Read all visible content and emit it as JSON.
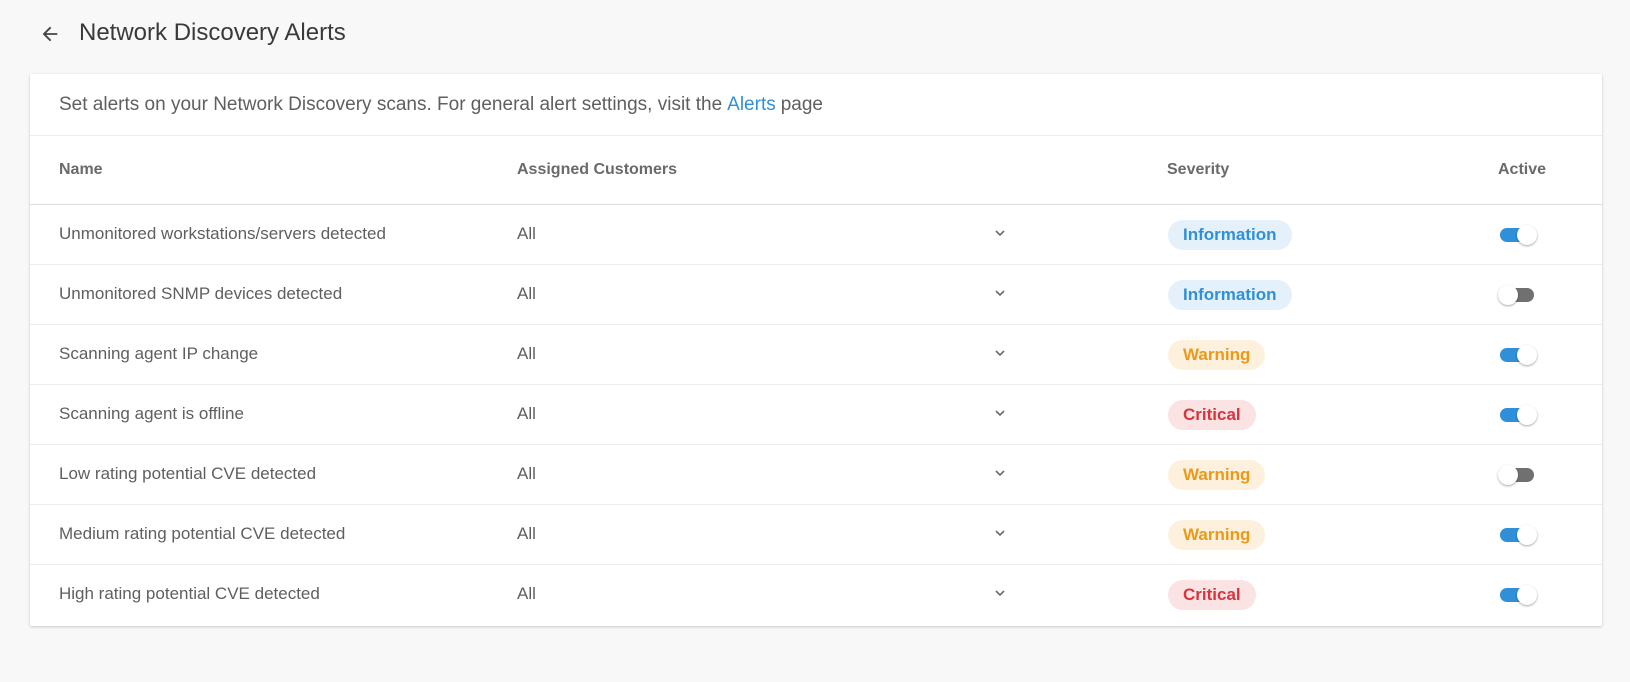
{
  "header": {
    "title": "Network Discovery Alerts",
    "back_icon": "arrow-left-icon"
  },
  "intro": {
    "text_before": "Set alerts on your Network Discovery scans. For general alert settings, visit the",
    "link_label": "Alerts",
    "text_after": "page"
  },
  "table": {
    "columns": {
      "name": "Name",
      "customers": "Assigned Customers",
      "severity": "Severity",
      "active": "Active"
    },
    "rows": [
      {
        "name": "Unmonitored workstations/servers detected",
        "customers": "All",
        "severity": "Information",
        "level": "info",
        "active": true
      },
      {
        "name": "Unmonitored SNMP devices detected",
        "customers": "All",
        "severity": "Information",
        "level": "info",
        "active": false
      },
      {
        "name": "Scanning agent IP change",
        "customers": "All",
        "severity": "Warning",
        "level": "warn",
        "active": true
      },
      {
        "name": "Scanning agent is offline",
        "customers": "All",
        "severity": "Critical",
        "level": "crit",
        "active": true
      },
      {
        "name": "Low rating potential CVE detected",
        "customers": "All",
        "severity": "Warning",
        "level": "warn",
        "active": false
      },
      {
        "name": "Medium rating potential CVE detected",
        "customers": "All",
        "severity": "Warning",
        "level": "warn",
        "active": true
      },
      {
        "name": "High rating potential CVE detected",
        "customers": "All",
        "severity": "Critical",
        "level": "crit",
        "active": true
      }
    ]
  },
  "colors": {
    "accent": "#2f8fd8",
    "information": "#2f8fd8",
    "warning": "#ee9818",
    "critical": "#d9343d",
    "toggle_off": "#707070"
  }
}
